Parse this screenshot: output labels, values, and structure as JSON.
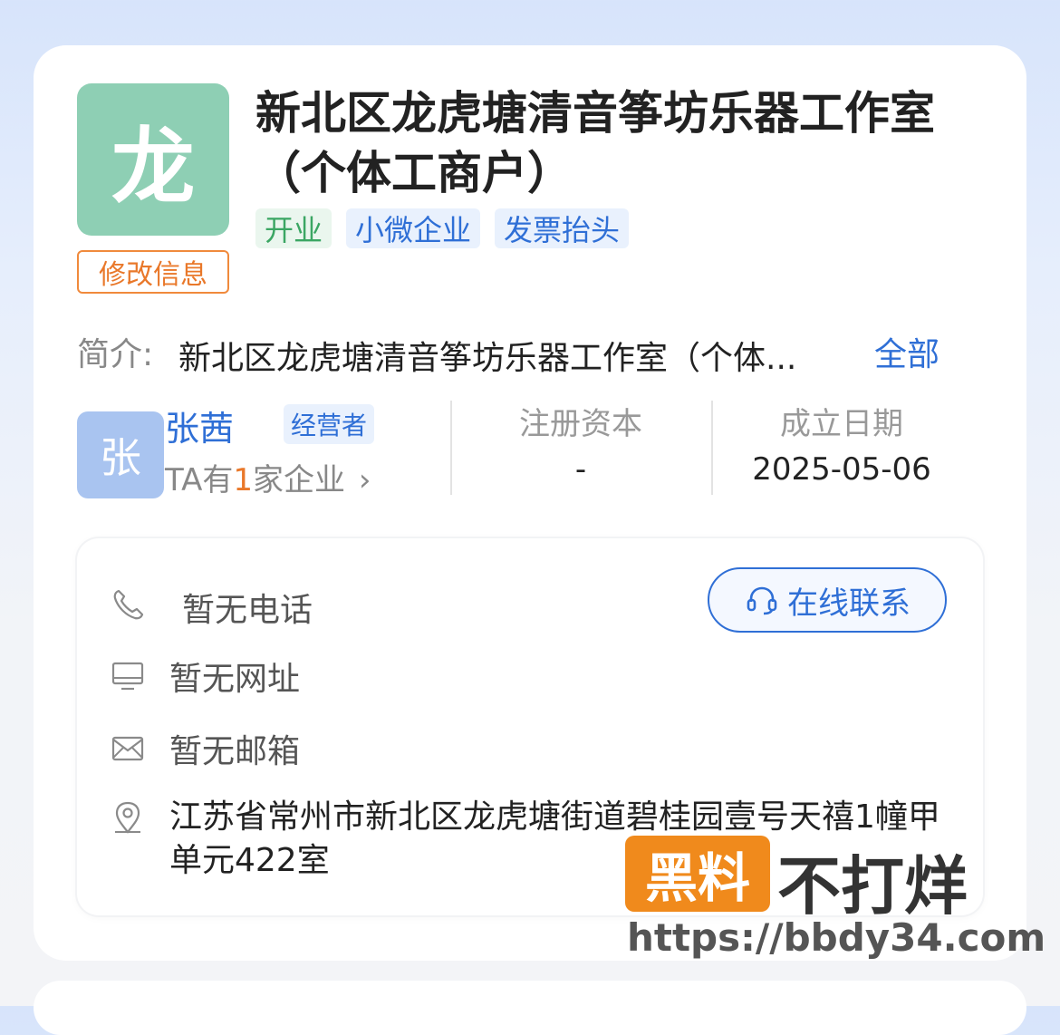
{
  "company": {
    "logo_char": "龙",
    "edit_label": "修改信息",
    "name": "新北区龙虎塘清音筝坊乐器工作室（个体工商户）",
    "tags": [
      {
        "label": "开业",
        "style": "green"
      },
      {
        "label": "小微企业",
        "style": "blue"
      },
      {
        "label": "发票抬头",
        "style": "blue"
      }
    ]
  },
  "intro": {
    "label": "简介:",
    "text": "新北区龙虎塘清音筝坊乐器工作室（个体...",
    "more_label": "全部"
  },
  "owner": {
    "avatar_char": "张",
    "name": "张茜",
    "role": "经营者",
    "count_prefix": "TA有",
    "count_num": "1",
    "count_suffix": "家企业",
    "chevron": "›"
  },
  "stats": {
    "capital_label": "注册资本",
    "capital_value": "-",
    "date_label": "成立日期",
    "date_value": "2025-05-06"
  },
  "contact": {
    "phone": "暂无电话",
    "website": "暂无网址",
    "email": "暂无邮箱",
    "address": "江苏省常州市新北区龙虎塘街道碧桂园壹号天禧1幢甲单元422室",
    "online_label": "在线联系"
  },
  "watermark": {
    "badge": "黑料",
    "text": "不打烊",
    "url": "https://bbdy34.com"
  },
  "colors": {
    "brand_blue": "#2f6fd6",
    "accent_orange": "#e9782a",
    "logo_green": "#8ecfb4",
    "avatar_blue": "#a9c4f0"
  }
}
